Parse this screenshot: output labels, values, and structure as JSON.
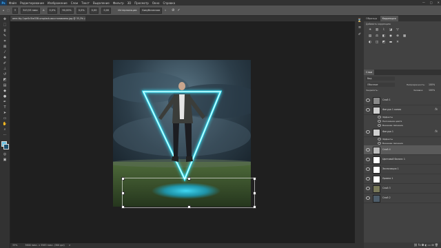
{
  "menu": {
    "logo": "Ps",
    "items": [
      "Файл",
      "Редактирование",
      "Изображение",
      "Слои",
      "Текст",
      "Выделение",
      "Фильтр",
      "3D",
      "Просмотр",
      "Окно",
      "Справка"
    ],
    "window_buttons": [
      "—",
      "□",
      "✕"
    ]
  },
  "options": {
    "zoom_values": [
      "343,53 пикс",
      "0,0%",
      "180,0",
      "90,00%",
      "0,0%",
      "0,00",
      "0,00"
    ],
    "interp_label": "Интерполяция:",
    "interp_value": "Бикубическая",
    "cancel_icon": "cancel-icon",
    "commit_icon": "commit-icon"
  },
  "document": {
    "tab_title": "ame-tky-1rpe5c5iw338-unsplash-восстановлено.jpg @ 33,3% (Слой 4, RGB/8*) ×"
  },
  "status": {
    "zoom": "33%",
    "doc_info": "3600 пикс. x 3583 пикс. (300 ppi)",
    "arrow": ">"
  },
  "right_panel": {
    "tabs": [
      "Образцы",
      "Коррекция"
    ],
    "adjust_heading": "Добавить коррекцию",
    "layers_tab": "Слои",
    "blend_mode": "Обычные",
    "opacity_label": "Непрозрачность:",
    "opacity_value": "100%",
    "lock_label": "Закрепить:",
    "fill_label": "Заливка:",
    "fill_value": "100%",
    "search_placeholder": "Вид"
  },
  "layers": [
    {
      "name": "Слой 1",
      "thumb": "#8a8a8a",
      "fx": false,
      "sub": false
    },
    {
      "name": "Фигура 1 копия",
      "thumb": "#cfcfcf",
      "fx": true,
      "sub": false
    },
    {
      "name": "Эффекты",
      "sub": true
    },
    {
      "name": "Наложение цвета",
      "sub": true
    },
    {
      "name": "Внешнее свечение",
      "sub": true
    },
    {
      "name": "Фигура 1",
      "thumb": "#cfcfcf",
      "fx": true,
      "sub": false
    },
    {
      "name": "Эффекты",
      "sub": true
    },
    {
      "name": "Внешнее свечение",
      "sub": true
    },
    {
      "name": "Слой 4",
      "thumb": "#bdbdbd",
      "fx": false,
      "sub": false
    },
    {
      "name": "Цветовой баланс 1",
      "thumb": "#ffffff",
      "fx": false,
      "sub": false
    },
    {
      "name": "Экспозиция 1",
      "thumb": "#ffffff",
      "fx": false,
      "sub": false
    },
    {
      "name": "Уровни 1",
      "thumb": "#ffffff",
      "fx": false,
      "sub": false
    },
    {
      "name": "Слой 3",
      "thumb": "#7a7a5a",
      "fx": false,
      "sub": false
    },
    {
      "name": "Слой 2",
      "thumb": "#4d5d6a",
      "fx": false,
      "sub": false
    }
  ],
  "colors": {
    "neon": "#38e8ff",
    "accent": "#31a8ff"
  }
}
